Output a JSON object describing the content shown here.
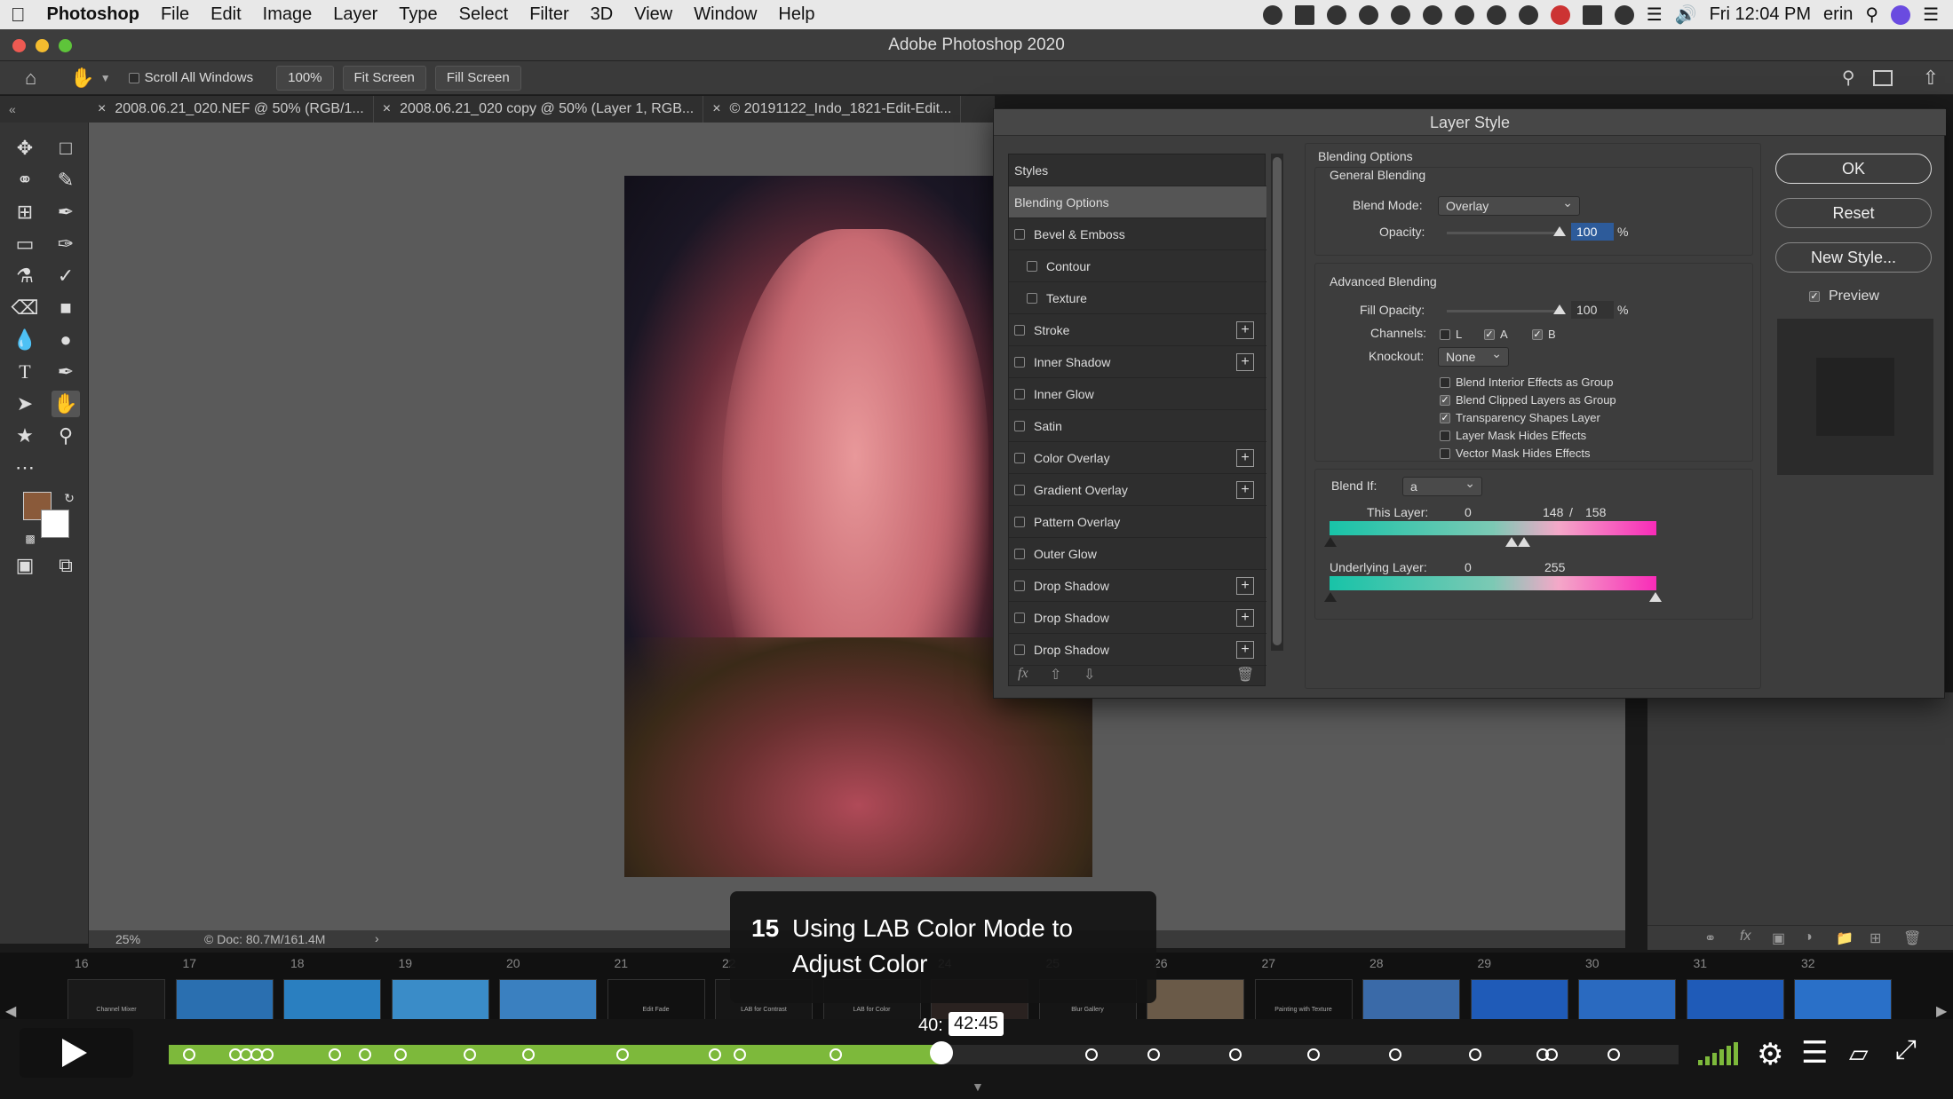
{
  "menubar": {
    "apple": "",
    "app": "Photoshop",
    "items": [
      "File",
      "Edit",
      "Image",
      "Layer",
      "Type",
      "Select",
      "Filter",
      "3D",
      "View",
      "Window",
      "Help"
    ],
    "clock": "Fri 12:04 PM",
    "user": "erin"
  },
  "window": {
    "title": "Adobe Photoshop 2020"
  },
  "options": {
    "scroll_all": "Scroll All Windows",
    "zoom": "100%",
    "fit_screen": "Fit Screen",
    "fill_screen": "Fill Screen"
  },
  "tabs": [
    "2008.06.21_020.NEF @ 50% (RGB/1...",
    "2008.06.21_020 copy @ 50% (Layer 1, RGB...",
    "© 20191122_Indo_1821-Edit-Edit..."
  ],
  "status": {
    "zoom": "25%",
    "doc": "Doc: 80.7M/161.4M"
  },
  "dialog": {
    "title": "Layer Style",
    "styles_header": "Styles",
    "styles": [
      {
        "label": "Blending Options",
        "check": false,
        "plus": false,
        "selected": true
      },
      {
        "label": "Bevel & Emboss",
        "check": true,
        "plus": false
      },
      {
        "label": "Contour",
        "check": true,
        "plus": false,
        "indent": true
      },
      {
        "label": "Texture",
        "check": true,
        "plus": false,
        "indent": true
      },
      {
        "label": "Stroke",
        "check": true,
        "plus": true
      },
      {
        "label": "Inner Shadow",
        "check": true,
        "plus": true
      },
      {
        "label": "Inner Glow",
        "check": true,
        "plus": false
      },
      {
        "label": "Satin",
        "check": true,
        "plus": false
      },
      {
        "label": "Color Overlay",
        "check": true,
        "plus": true
      },
      {
        "label": "Gradient Overlay",
        "check": true,
        "plus": true
      },
      {
        "label": "Pattern Overlay",
        "check": true,
        "plus": false
      },
      {
        "label": "Outer Glow",
        "check": true,
        "plus": false
      },
      {
        "label": "Drop Shadow",
        "check": true,
        "plus": true
      },
      {
        "label": "Drop Shadow",
        "check": true,
        "plus": true
      },
      {
        "label": "Drop Shadow",
        "check": true,
        "plus": true
      }
    ],
    "fx": "fx",
    "blending_options": "Blending Options",
    "general_blending": "General Blending",
    "blend_mode_label": "Blend Mode:",
    "blend_mode": "Overlay",
    "opacity_label": "Opacity:",
    "opacity": "100",
    "percent": "%",
    "advanced_blending": "Advanced Blending",
    "fill_opacity_label": "Fill Opacity:",
    "fill_opacity": "100",
    "channels_label": "Channels:",
    "channel_l": "L",
    "channel_a": "A",
    "channel_b": "B",
    "knockout_label": "Knockout:",
    "knockout": "None",
    "options": [
      {
        "label": "Blend Interior Effects as Group",
        "checked": false
      },
      {
        "label": "Blend Clipped Layers as Group",
        "checked": true
      },
      {
        "label": "Transparency Shapes Layer",
        "checked": true
      },
      {
        "label": "Layer Mask Hides Effects",
        "checked": false
      },
      {
        "label": "Vector Mask Hides Effects",
        "checked": false
      }
    ],
    "blend_if_label": "Blend If:",
    "blend_if": "a",
    "this_layer_label": "This Layer:",
    "this_layer_low": "0",
    "this_layer_high": "148",
    "slash": "/",
    "this_layer_high2": "158",
    "underlying_label": "Underlying Layer:",
    "underlying_low": "0",
    "underlying_high": "255",
    "ok": "OK",
    "reset": "Reset",
    "new_style": "New Style...",
    "preview": "Preview"
  },
  "video": {
    "chapter_number": "15",
    "chapter_title_1": "Using LAB Color Mode to",
    "chapter_title_2": "Adjust Color",
    "time_partial": "40:",
    "time": "42:45",
    "progress": 0.512,
    "thumb_numbers": [
      "16",
      "17",
      "18",
      "19",
      "20",
      "21",
      "22",
      "23",
      "24",
      "25",
      "26",
      "27",
      "28",
      "29",
      "30",
      "31",
      "32"
    ],
    "thumb_captions": [
      "Channel Mixer",
      "",
      "",
      "",
      "",
      "Edit Fade",
      "LAB for Contrast",
      "LAB for Color",
      "",
      "Blur Gallery",
      "",
      "Painting with Texture",
      "",
      "",
      "",
      "",
      ""
    ]
  },
  "colors": {
    "accent_green": "#7db93b",
    "teal": "#18c3a8",
    "magenta": "#f82bb8",
    "fg_swatch": "#8a5a3a"
  },
  "icons": [
    "move-icon",
    "marquee-icon",
    "lasso-icon",
    "quick-select-icon",
    "crop-icon",
    "eyedropper-icon",
    "healing-icon",
    "brush-icon",
    "stamp-icon",
    "history-brush-icon",
    "eraser-icon",
    "gradient-icon",
    "blur-icon",
    "dodge-icon",
    "type-icon",
    "pen-icon",
    "path-select-icon",
    "hand-icon",
    "shape-icon",
    "zoom-icon"
  ]
}
